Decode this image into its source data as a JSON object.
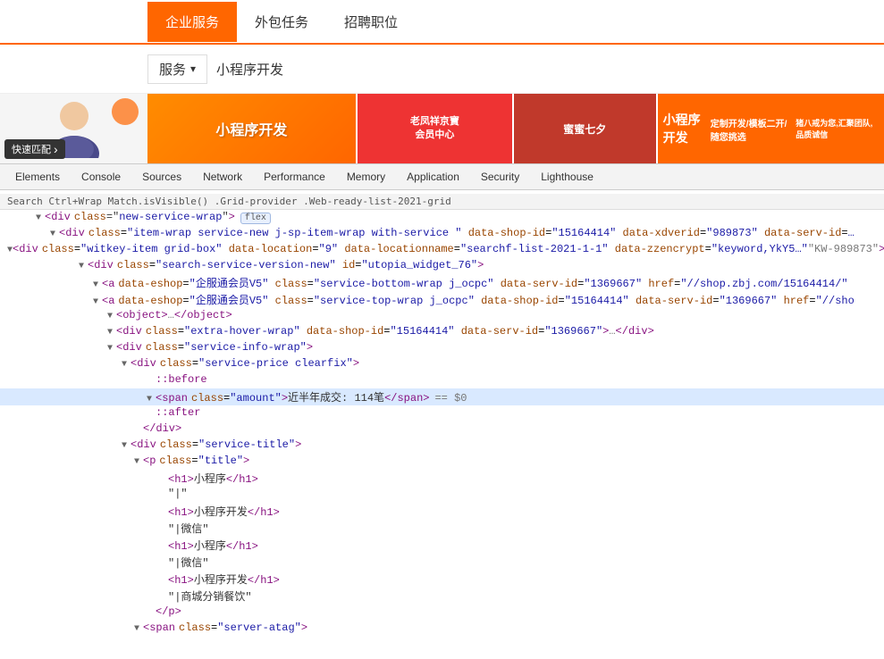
{
  "website": {
    "nav": {
      "items": [
        {
          "label": "企业服务",
          "active": true
        },
        {
          "label": "外包任务",
          "active": false
        },
        {
          "label": "招聘职位",
          "active": false
        }
      ]
    },
    "search": {
      "dropdown": "服务",
      "query": "小程序开发"
    },
    "fastMatch": "快速匹配",
    "banners": [
      {
        "text": "小程序开发",
        "style": "orange"
      },
      {
        "text": "老凤祥京寶\n会员中心",
        "style": "red"
      },
      {
        "text": "蜜蜜七夕",
        "style": "purple"
      },
      {
        "text": "小程序开发\n定制开发/模板二开/随您挑选\n猪八戒为您,汇聚团队,品质诚信",
        "style": "orange2"
      }
    ]
  },
  "devtools": {
    "tabs": [
      {
        "label": "Elements"
      },
      {
        "label": "Console"
      },
      {
        "label": "Sources"
      },
      {
        "label": "Network"
      },
      {
        "label": "Performance"
      },
      {
        "label": "Memory"
      },
      {
        "label": "Application"
      },
      {
        "label": "Security"
      },
      {
        "label": "Lighthouse"
      }
    ]
  },
  "dom": {
    "breadcrumb": "Search Ctrl+Wrap Match.isVisible() .Grid-provider .Web-ready-list-2021-grid",
    "lines": [
      {
        "indent": 2,
        "type": "open-tag",
        "content": "<div class=\"new-service-wrap\">",
        "badge": "flex",
        "highlight": false
      },
      {
        "indent": 3,
        "type": "open-tag",
        "content": "<div class=\"item-wrap service-new j-sp-item-wrap  with-service \" data-shop-id=\"15164414\" data-xdverid=\"989873\" data-serv-id=…",
        "highlight": false
      },
      {
        "indent": 4,
        "type": "open-tag",
        "content": "<div class=\"witkey-item grid-box\" data-location=\"9\" data-locationname=\"searchf-list-2021-1-1\" data-zzencrypt=\"keyword,YkY5…\"KW-989873\">",
        "highlight": false
      },
      {
        "indent": 5,
        "type": "open-tag",
        "content": "<div class=\"search-service-version-new\" id=\"utopia_widget_76\">",
        "highlight": false
      },
      {
        "indent": 6,
        "type": "open-tag",
        "content": "<a data-eshop=\"企服通会员V5\" class=\"service-bottom-wrap j_ocpc\" data-serv-id=\"1369667\" href=\"//shop.zbj.com/15164414/\"",
        "highlight": false
      },
      {
        "indent": 6,
        "type": "open-tag",
        "content": "<a data-eshop=\"企服通会员V5\" class=\"service-top-wrap j_ocpc\" data-shop-id=\"15164414\" data-serv-id=\"1369667\" href=\"//sho",
        "highlight": false
      },
      {
        "indent": 7,
        "type": "open-tag",
        "content": "<object>…</object>",
        "highlight": false
      },
      {
        "indent": 7,
        "type": "open-tag",
        "content": "<div class=\"extra-hover-wrap\" data-shop-id=\"15164414\" data-serv-id=\"1369667\">…</div>",
        "highlight": false
      },
      {
        "indent": 7,
        "type": "open-tag",
        "content": "<div class=\"service-info-wrap\">",
        "highlight": false
      },
      {
        "indent": 8,
        "type": "open-tag",
        "content": "<div class=\"service-price clearfix\">",
        "highlight": false
      },
      {
        "indent": 9,
        "type": "pseudo",
        "content": "::before",
        "highlight": false
      },
      {
        "indent": 9,
        "type": "selected",
        "content": "<span class=\"amount\">近半年成交: 114笔</span> == $0",
        "highlight": true
      },
      {
        "indent": 9,
        "type": "pseudo",
        "content": "::after",
        "highlight": false
      },
      {
        "indent": 8,
        "type": "close-tag",
        "content": "</div>",
        "highlight": false
      },
      {
        "indent": 8,
        "type": "open-tag",
        "content": "<div class=\"service-title\">",
        "highlight": false
      },
      {
        "indent": 9,
        "type": "open-tag",
        "content": "<p class=\"title\">",
        "highlight": false
      },
      {
        "indent": 10,
        "type": "text",
        "content": "<h1>小程序</h1>",
        "highlight": false
      },
      {
        "indent": 10,
        "type": "text",
        "content": "\"|\"",
        "highlight": false
      },
      {
        "indent": 10,
        "type": "text",
        "content": "<h1>小程序开发</h1>",
        "highlight": false
      },
      {
        "indent": 10,
        "type": "text",
        "content": "\"|微信\"",
        "highlight": false
      },
      {
        "indent": 10,
        "type": "text",
        "content": "<h1>小程序</h1>",
        "highlight": false
      },
      {
        "indent": 10,
        "type": "text",
        "content": "\"|微信\"",
        "highlight": false
      },
      {
        "indent": 10,
        "type": "text",
        "content": "<h1>小程序开发</h1>",
        "highlight": false
      },
      {
        "indent": 10,
        "type": "text",
        "content": "\"|商城分销餐饮\"",
        "highlight": false
      },
      {
        "indent": 9,
        "type": "close-tag",
        "content": "</p>",
        "highlight": false
      },
      {
        "indent": 8,
        "type": "open-tag",
        "content": "<span class=\"server-atag\">",
        "highlight": false
      }
    ]
  }
}
